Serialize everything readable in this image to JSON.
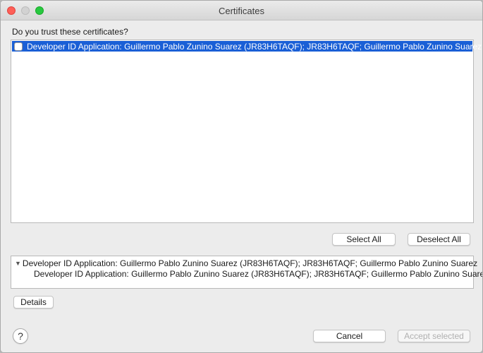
{
  "window": {
    "title": "Certificates"
  },
  "prompt": "Do you trust these certificates?",
  "certificates": [
    {
      "label": "Developer ID Application: Guillermo Pablo Zunino Suarez (JR83H6TAQF); JR83H6TAQF; Guillermo Pablo Zunino Suarez",
      "checked": false,
      "selected": true
    }
  ],
  "buttons": {
    "select_all": "Select All",
    "deselect_all": "Deselect All",
    "details": "Details",
    "cancel": "Cancel",
    "accept_selected": "Accept selected",
    "help": "?"
  },
  "details_tree": {
    "parent": "Developer ID Application: Guillermo Pablo Zunino Suarez (JR83H6TAQF); JR83H6TAQF; Guillermo Pablo Zunino Suarez",
    "child": "Developer ID Application: Guillermo Pablo Zunino Suarez (JR83H6TAQF); JR83H6TAQF; Guillermo Pablo Zunino Suarez"
  },
  "icons": {
    "expand": "triangle-down-icon",
    "help": "question-mark-icon"
  },
  "colors": {
    "selection": "#1a5fd6",
    "close": "#fe5f57",
    "maximize": "#28c840"
  }
}
